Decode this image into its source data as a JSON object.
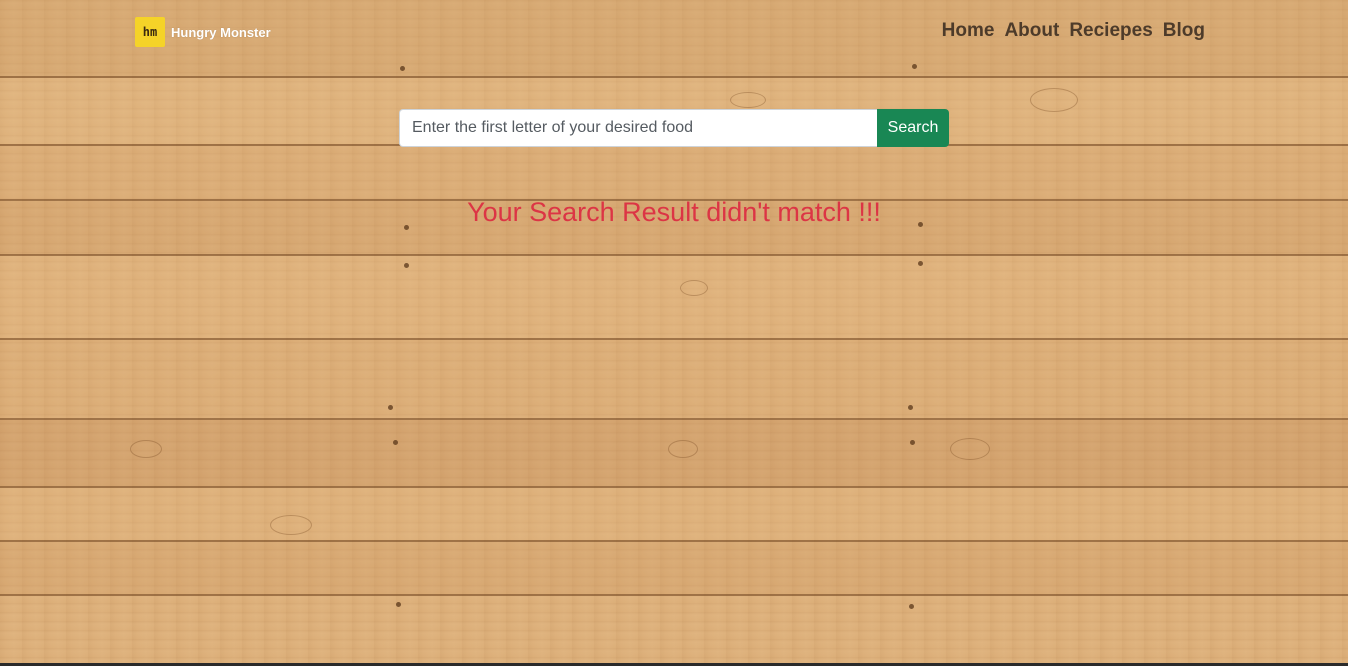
{
  "brand": {
    "logo_text": "hm",
    "name": "Hungry Monster",
    "logo_color": "#f5d328"
  },
  "nav": {
    "items": [
      {
        "label": "Home"
      },
      {
        "label": "About"
      },
      {
        "label": "Reciepes"
      },
      {
        "label": "Blog"
      }
    ]
  },
  "search": {
    "placeholder": "Enter the first letter of your desired food",
    "value": "",
    "button_label": "Search",
    "button_color": "#198754"
  },
  "result": {
    "message": "Your Search Result didn't match !!!",
    "message_color": "#dc3545"
  },
  "background": {
    "style": "wood-planks"
  }
}
